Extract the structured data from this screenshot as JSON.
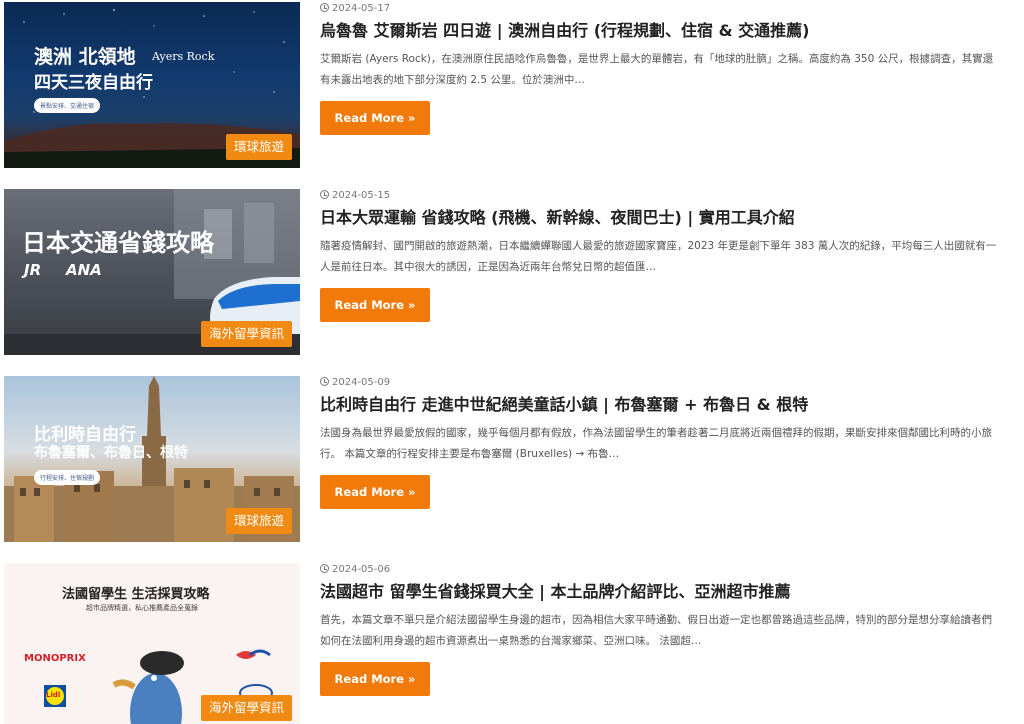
{
  "posts": [
    {
      "date": "2024-05-17",
      "title": "烏魯魯 艾爾斯岩 四日遊 | 澳洲自由行 (行程規劃、住宿 & 交通推薦)",
      "excerpt": "艾爾斯岩 (Ayers Rock)，在澳洲原住民語唸作烏魯魯，是世界上最大的單體岩，有「地球的肚臍」之稱。高度約為 350 公尺，根據調查，其實還有未露出地表的地下部分深度約 2.5 公里。位於澳洲中…",
      "button": "Read More »",
      "badge": "環球旅遊",
      "img": {
        "line1": "澳洲 北領地",
        "line1b": "Ayers Rock",
        "line2": "四天三夜自由行",
        "pill": "景點安排、交通住宿"
      }
    },
    {
      "date": "2024-05-15",
      "title": "日本大眾運輸 省錢攻略 (飛機、新幹線、夜間巴士) | 實用工具介紹",
      "excerpt": "隨著疫情解封、國門開啟的旅遊熱潮，日本繼續蟬聯國人最愛的旅遊國家寶座，2023 年更是創下單年 383 萬人次的紀錄，平均每三人出國就有一人是前往日本。其中很大的誘因，正是因為近兩年台幣兌日幣的超值匯…",
      "button": "Read More »",
      "badge": "海外留學資訊",
      "img": {
        "line1": "日本交通省錢攻略",
        "jr": "JR",
        "ana": "ANA"
      }
    },
    {
      "date": "2024-05-09",
      "title": "比利時自由行 走進中世紀絕美童話小鎮 | 布魯塞爾 + 布魯日 & 根特",
      "excerpt": "法國身為最世界最愛放假的國家，幾乎每個月都有假放，作為法國留學生的筆者趁著二月底將近兩個禮拜的假期，果斷安排來個鄰國比利時的小旅行。 本篇文章的行程安排主要是布魯塞爾 (Bruxelles) → 布魯…",
      "button": "Read More »",
      "badge": "環球旅遊",
      "img": {
        "line1": "比利時自由行",
        "line2": "布魯塞爾、布魯日、根特",
        "pill": "行程安排、住宿規劃"
      }
    },
    {
      "date": "2024-05-06",
      "title": "法國超市 留學生省錢採買大全 | 本土品牌介紹評比、亞洲超市推薦",
      "excerpt": "首先，本篇文章不單只是介紹法國留學生身邊的超市，因為相信大家平時通勤、假日出遊一定也都曾路過這些品牌，特別的部分是想分享給讀者們如何在法國利用身邊的超市資源煮出一桌熟悉的台灣家鄉菜、亞洲口味。 法國超…",
      "button": "Read More »",
      "badge": "海外留學資訊",
      "img": {
        "line1": "法國留學生 生活採買攻略",
        "line2": "超市品牌精選，私心推薦產品全蒐錄",
        "brand1": "MONOPRIX",
        "brand2": "Lidl"
      }
    }
  ]
}
